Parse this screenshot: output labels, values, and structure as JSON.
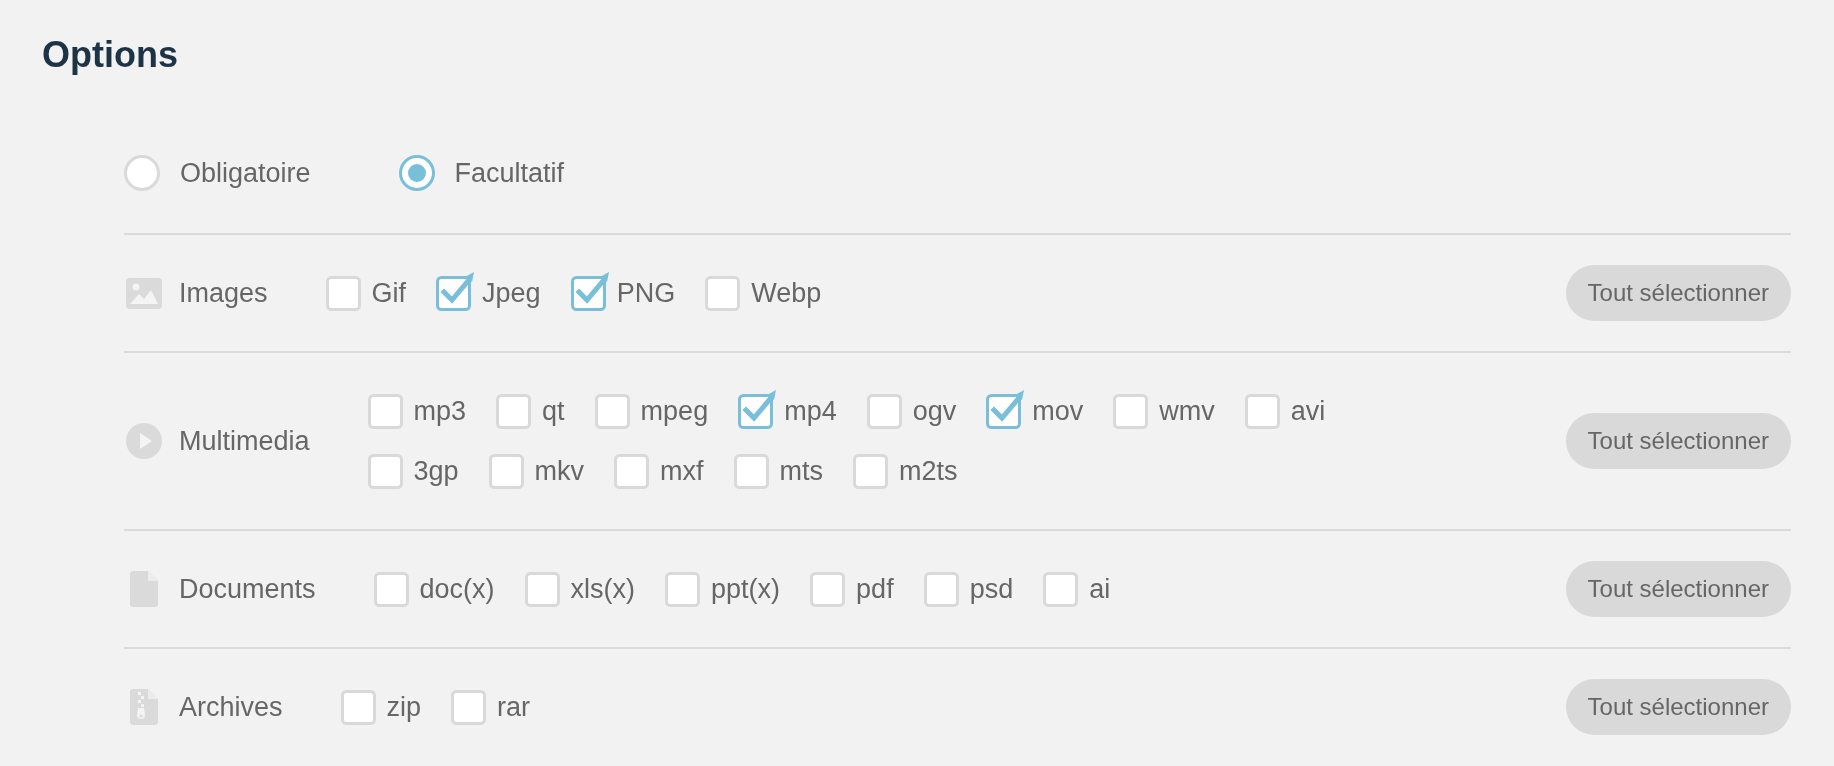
{
  "title": "Options",
  "requirement": [
    {
      "label": "Obligatoire",
      "selected": false
    },
    {
      "label": "Facultatif",
      "selected": true
    }
  ],
  "categories": [
    {
      "kind": "images",
      "label": "Images",
      "lines": [
        [
          {
            "label": "Gif",
            "checked": false
          },
          {
            "label": "Jpeg",
            "checked": true
          },
          {
            "label": "PNG",
            "checked": true
          },
          {
            "label": "Webp",
            "checked": false
          }
        ]
      ],
      "button": "Tout sélectionner"
    },
    {
      "kind": "multimedia",
      "label": "Multimedia",
      "lines": [
        [
          {
            "label": "mp3",
            "checked": false
          },
          {
            "label": "qt",
            "checked": false
          },
          {
            "label": "mpeg",
            "checked": false
          },
          {
            "label": "mp4",
            "checked": true
          },
          {
            "label": "ogv",
            "checked": false
          },
          {
            "label": "mov",
            "checked": true
          },
          {
            "label": "wmv",
            "checked": false
          },
          {
            "label": "avi",
            "checked": false
          }
        ],
        [
          {
            "label": "3gp",
            "checked": false
          },
          {
            "label": "mkv",
            "checked": false
          },
          {
            "label": "mxf",
            "checked": false
          },
          {
            "label": "mts",
            "checked": false
          },
          {
            "label": "m2ts",
            "checked": false
          }
        ]
      ],
      "button": "Tout sélectionner"
    },
    {
      "kind": "documents",
      "label": "Documents",
      "lines": [
        [
          {
            "label": "doc(x)",
            "checked": false
          },
          {
            "label": "xls(x)",
            "checked": false
          },
          {
            "label": "ppt(x)",
            "checked": false
          },
          {
            "label": "pdf",
            "checked": false
          },
          {
            "label": "psd",
            "checked": false
          },
          {
            "label": "ai",
            "checked": false
          }
        ]
      ],
      "button": "Tout sélectionner"
    },
    {
      "kind": "archives",
      "label": "Archives",
      "lines": [
        [
          {
            "label": "zip",
            "checked": false
          },
          {
            "label": "rar",
            "checked": false
          }
        ]
      ],
      "button": "Tout sélectionner"
    }
  ]
}
